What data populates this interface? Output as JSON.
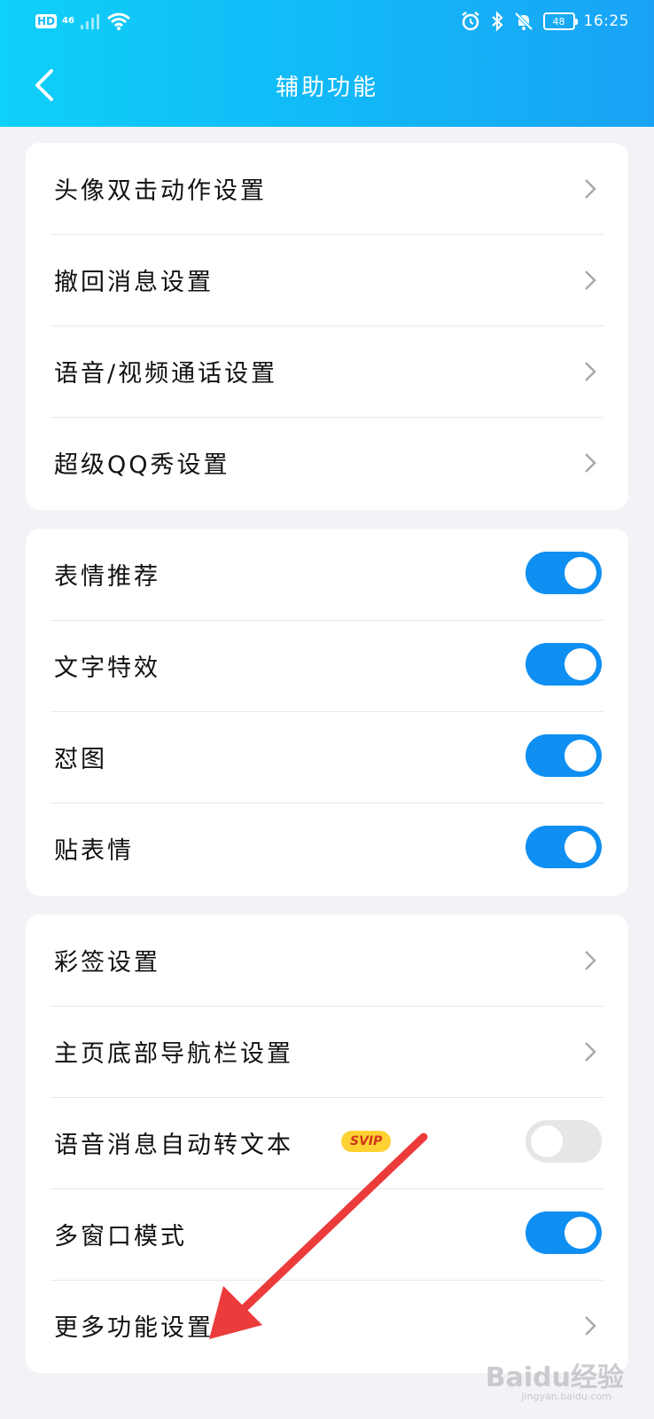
{
  "status_bar": {
    "hd": "HD",
    "network": "46",
    "battery": "48",
    "time": "16:25"
  },
  "header": {
    "title": "辅助功能"
  },
  "groups": [
    {
      "rows": [
        {
          "label": "头像双击动作设置",
          "control": "chevron"
        },
        {
          "label": "撤回消息设置",
          "control": "chevron"
        },
        {
          "label": "语音/视频通话设置",
          "control": "chevron"
        },
        {
          "label": "超级QQ秀设置",
          "control": "chevron"
        }
      ]
    },
    {
      "rows": [
        {
          "label": "表情推荐",
          "control": "toggle",
          "on": true
        },
        {
          "label": "文字特效",
          "control": "toggle",
          "on": true
        },
        {
          "label": "怼图",
          "control": "toggle",
          "on": true
        },
        {
          "label": "贴表情",
          "control": "toggle",
          "on": true
        }
      ]
    },
    {
      "rows": [
        {
          "label": "彩签设置",
          "control": "chevron"
        },
        {
          "label": "主页底部导航栏设置",
          "control": "chevron"
        },
        {
          "label": "语音消息自动转文本",
          "control": "toggle",
          "on": false,
          "badge": "SVIP"
        },
        {
          "label": "多窗口模式",
          "control": "toggle",
          "on": true
        },
        {
          "label": "更多功能设置",
          "control": "chevron"
        }
      ]
    }
  ],
  "watermark": {
    "text": "Baidu经验",
    "sub": "jingyan.baidu.com"
  },
  "colors": {
    "accent": "#0f8ff2",
    "header_start": "#0fd0f8",
    "header_end": "#1aa3f6",
    "annotation_arrow": "#ec3b3b"
  }
}
